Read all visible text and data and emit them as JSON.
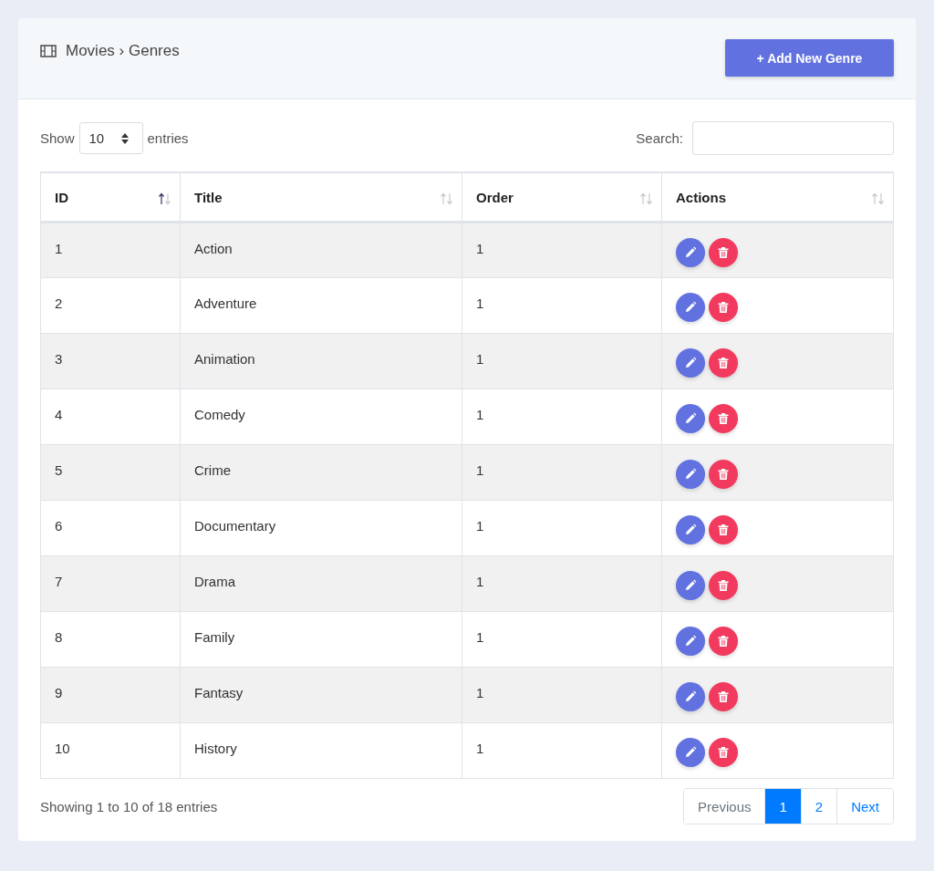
{
  "header": {
    "breadcrumb": "Movies › Genres",
    "add_button": "+ Add New Genre"
  },
  "length": {
    "show_label": "Show",
    "value": "10",
    "entries_label": "entries"
  },
  "search": {
    "label": "Search:"
  },
  "table": {
    "columns": [
      {
        "label": "ID",
        "sorted": true
      },
      {
        "label": "Title",
        "sorted": false
      },
      {
        "label": "Order",
        "sorted": false
      },
      {
        "label": "Actions",
        "sorted": false
      }
    ],
    "rows": [
      {
        "id": "1",
        "title": "Action",
        "order": "1"
      },
      {
        "id": "2",
        "title": "Adventure",
        "order": "1"
      },
      {
        "id": "3",
        "title": "Animation",
        "order": "1"
      },
      {
        "id": "4",
        "title": "Comedy",
        "order": "1"
      },
      {
        "id": "5",
        "title": "Crime",
        "order": "1"
      },
      {
        "id": "6",
        "title": "Documentary",
        "order": "1"
      },
      {
        "id": "7",
        "title": "Drama",
        "order": "1"
      },
      {
        "id": "8",
        "title": "Family",
        "order": "1"
      },
      {
        "id": "9",
        "title": "Fantasy",
        "order": "1"
      },
      {
        "id": "10",
        "title": "History",
        "order": "1"
      }
    ]
  },
  "info": "Showing 1 to 10 of 18 entries",
  "pagination": {
    "previous": {
      "label": "Previous",
      "disabled": true
    },
    "pages": [
      {
        "label": "1",
        "selected": true
      },
      {
        "label": "2",
        "selected": false
      }
    ],
    "next": {
      "label": "Next",
      "disabled": false
    }
  }
}
